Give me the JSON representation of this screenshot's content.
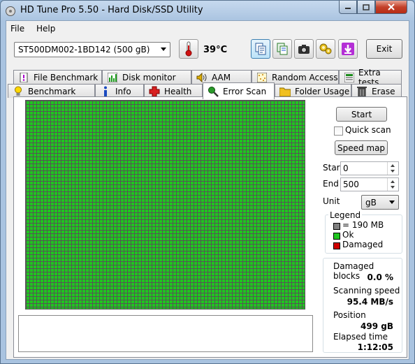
{
  "window": {
    "title": "HD Tune Pro 5.50 - Hard Disk/SSD Utility"
  },
  "menu": {
    "file": "File",
    "help": "Help"
  },
  "toolbar": {
    "drive": "ST500DM002-1BD142 (500 gB)",
    "temperature": "39",
    "temperature_unit": "°C",
    "exit_label": "Exit",
    "icons": [
      "copy-icon",
      "copy-text-icon",
      "camera-icon",
      "settings-icon",
      "download-icon"
    ]
  },
  "tabs": {
    "row1": [
      {
        "label": "File Benchmark",
        "icon": "file-benchmark-icon"
      },
      {
        "label": "Disk monitor",
        "icon": "disk-monitor-icon"
      },
      {
        "label": "AAM",
        "icon": "speaker-icon"
      },
      {
        "label": "Random Access",
        "icon": "random-access-icon"
      },
      {
        "label": "Extra tests",
        "icon": "extra-tests-icon"
      }
    ],
    "row2": [
      {
        "label": "Benchmark",
        "icon": "lightbulb-icon"
      },
      {
        "label": "Info",
        "icon": "info-icon"
      },
      {
        "label": "Health",
        "icon": "health-cross-icon"
      },
      {
        "label": "Error Scan",
        "icon": "magnifier-icon"
      },
      {
        "label": "Folder Usage",
        "icon": "folder-icon"
      },
      {
        "label": "Erase",
        "icon": "trash-icon"
      }
    ],
    "active": "Error Scan"
  },
  "controls": {
    "start_button": "Start",
    "quick_scan_label": "Quick scan",
    "quick_scan_checked": false,
    "speed_map_button": "Speed map",
    "start_label": "Start",
    "start_value": "0",
    "end_label": "End",
    "end_value": "500",
    "unit_label": "Unit",
    "unit_value": "gB"
  },
  "legend": {
    "title": "Legend",
    "items": [
      {
        "label": "= 190 MB",
        "color": "#808080"
      },
      {
        "label": "Ok",
        "color": "#1fc61f"
      },
      {
        "label": "Damaged",
        "color": "#d00000"
      }
    ]
  },
  "stats": {
    "damaged_blocks_label": "Damaged blocks",
    "damaged_blocks_value": "0.0 %",
    "scanning_speed_label": "Scanning speed",
    "scanning_speed_value": "95.4 MB/s",
    "position_label": "Position",
    "position_value": "499 gB",
    "elapsed_label": "Elapsed time",
    "elapsed_value": "1:12:05"
  },
  "scan_grid": {
    "status": "all blocks ok",
    "ok_color": "#1fc61f"
  }
}
